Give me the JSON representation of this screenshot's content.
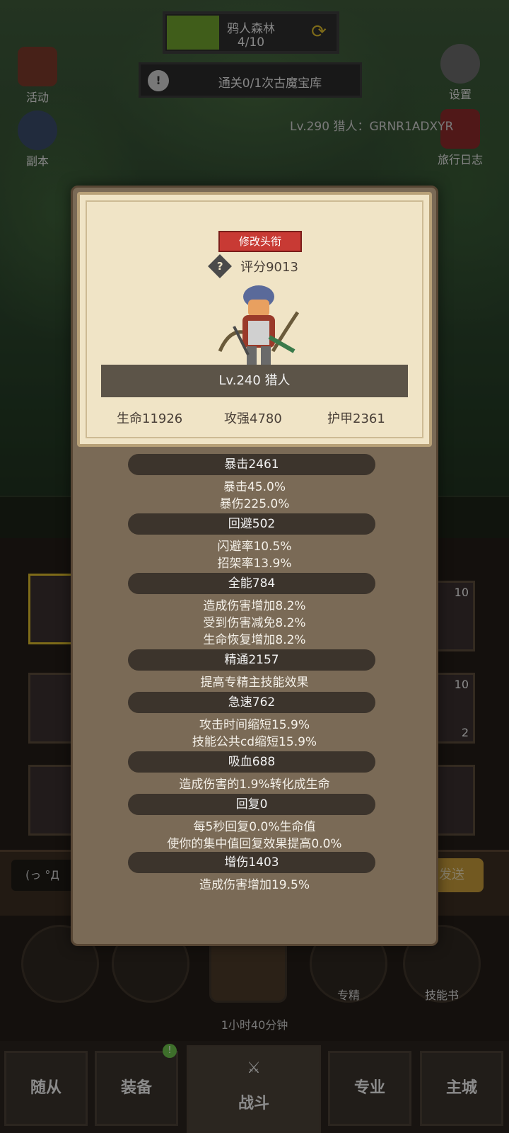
{
  "hud": {
    "map_title": "鸦人森林",
    "map_progress": "4/10",
    "map_progress_fraction": 0.3,
    "quest_text": "通关0/1次古魔宝库",
    "activity_label": "活动",
    "dungeon_label": "副本",
    "settings_label": "设置",
    "journal_label": "旅行日志",
    "player_info": "Lv.290 猎人：GRNR1ADXYR"
  },
  "slots": {
    "slot_a_count": "10",
    "slot_b_count": "10",
    "slot_b_sub": "2"
  },
  "chat": {
    "emote": "(っ °Д",
    "send_label": "发送"
  },
  "actions": {
    "specialization_label": "专精",
    "skillbook_label": "技能书",
    "chest_timer": "1小时40分钟"
  },
  "nav": {
    "followers": "随从",
    "equipment": "装备",
    "battle": "战斗",
    "profession": "专业",
    "main_city": "主城",
    "equipment_badge": "!"
  },
  "card": {
    "change_title": "修改头衔",
    "help": "?",
    "score": "评分9013",
    "level": "Lv.240 猎人",
    "hp": "生命11926",
    "attack": "攻强4780",
    "armor": "护甲2361"
  },
  "stats": [
    {
      "header": "暴击2461",
      "lines": [
        "暴击45.0%",
        "暴伤225.0%"
      ]
    },
    {
      "header": "回避502",
      "lines": [
        "闪避率10.5%",
        "招架率13.9%"
      ]
    },
    {
      "header": "全能784",
      "lines": [
        "造成伤害增加8.2%",
        "受到伤害减免8.2%",
        "生命恢复增加8.2%"
      ]
    },
    {
      "header": "精通2157",
      "lines": [
        "提高专精主技能效果"
      ]
    },
    {
      "header": "急速762",
      "lines": [
        "攻击时间缩短15.9%",
        "技能公共cd缩短15.9%"
      ]
    },
    {
      "header": "吸血688",
      "lines": [
        "造成伤害的1.9%转化成生命"
      ]
    },
    {
      "header": "回复0",
      "lines": [
        "每5秒回复0.0%生命值",
        "使你的集中值回复效果提高0.0%"
      ]
    },
    {
      "header": "增伤1403",
      "lines": [
        "造成伤害增加19.5%"
      ]
    }
  ]
}
